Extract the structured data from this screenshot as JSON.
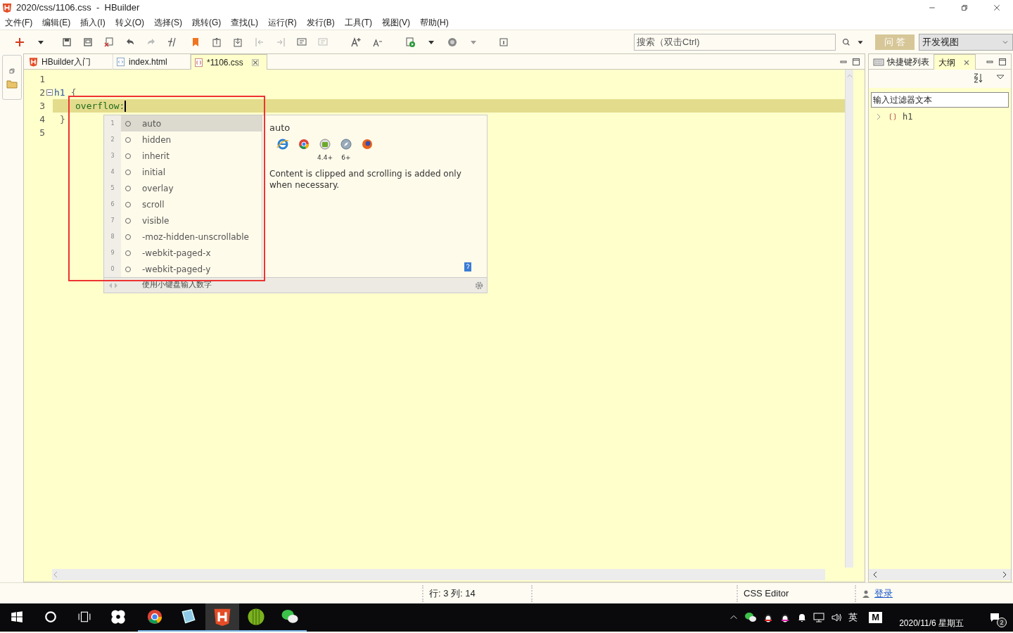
{
  "window": {
    "title": "2020/css/1106.css  -  HBuilder"
  },
  "menu": [
    "文件(F)",
    "编辑(E)",
    "插入(I)",
    "转义(O)",
    "选择(S)",
    "跳转(G)",
    "查找(L)",
    "运行(R)",
    "发行(B)",
    "工具(T)",
    "视图(V)",
    "帮助(H)"
  ],
  "toolbar": {
    "search": {
      "placeholder": "搜索（双击Ctrl)"
    },
    "qa_button": "问 答",
    "perspective": "开发视图"
  },
  "editor_tabs": [
    {
      "kind": "hbuilder",
      "label": "HBuilder入门",
      "selected": false
    },
    {
      "kind": "html",
      "label": "index.html",
      "selected": false
    },
    {
      "kind": "css",
      "label": "*1106.css",
      "selected": true
    }
  ],
  "code_lines": [
    {
      "number": "1",
      "current": false,
      "foldable": false
    },
    {
      "number": "2",
      "current": false,
      "foldable": true,
      "tokens": [
        {
          "kind": "selector",
          "text": "h1"
        },
        {
          "kind": "brace",
          "text": "{"
        }
      ]
    },
    {
      "number": "3",
      "current": true,
      "foldable": false,
      "tokens": [
        {
          "kind": "property",
          "text": "overflow:"
        }
      ]
    },
    {
      "number": "4",
      "current": false,
      "foldable": false,
      "tokens": [
        {
          "kind": "brace",
          "text": "}"
        }
      ]
    },
    {
      "number": "5",
      "current": false,
      "foldable": false
    }
  ],
  "autocomplete": {
    "items": [
      {
        "number": "1",
        "label": "auto",
        "selected": true
      },
      {
        "number": "2",
        "label": "hidden",
        "selected": false
      },
      {
        "number": "3",
        "label": "inherit",
        "selected": false
      },
      {
        "number": "4",
        "label": "initial",
        "selected": false
      },
      {
        "number": "5",
        "label": "overlay",
        "selected": false
      },
      {
        "number": "6",
        "label": "scroll",
        "selected": false
      },
      {
        "number": "7",
        "label": "visible",
        "selected": false
      },
      {
        "number": "8",
        "label": "-moz-hidden-unscrollable",
        "selected": false
      },
      {
        "number": "9",
        "label": "-webkit-paged-x",
        "selected": false
      },
      {
        "number": "0",
        "label": "-webkit-paged-y",
        "selected": false
      }
    ],
    "doc": {
      "title": "auto",
      "browsers": [
        {
          "kind": "ie"
        },
        {
          "kind": "chrome"
        },
        {
          "kind": "android",
          "version": "4.4+"
        },
        {
          "kind": "safari",
          "version": "6+"
        },
        {
          "kind": "firefox"
        }
      ],
      "description": "Content is clipped and scrolling is added only when necessary."
    },
    "footer": "使用小键盘输入数字"
  },
  "outline": {
    "tabs": [
      {
        "kind": "keyboard",
        "label": "快捷键列表",
        "selected": false
      },
      {
        "kind": "outline",
        "label": "大纲",
        "selected": true
      }
    ],
    "filter": {
      "placeholder": "输入过滤器文本"
    },
    "tree": [
      {
        "label": "h1",
        "expanded": false
      }
    ]
  },
  "status_bar": {
    "position": "行: 3 列: 14",
    "editor": "CSS Editor",
    "login": "登录"
  },
  "taskbar": {
    "apps": [
      {
        "kind": "chrome",
        "selected": false
      },
      {
        "kind": "notepad",
        "selected": false
      },
      {
        "kind": "hbuilder",
        "selected": true
      },
      {
        "kind": "leaf",
        "selected": false
      },
      {
        "kind": "wechat",
        "selected": false
      }
    ],
    "tray": {
      "ime": "英",
      "mode": "M",
      "date": "2020/11/6 星期五",
      "notifications": "2"
    }
  }
}
